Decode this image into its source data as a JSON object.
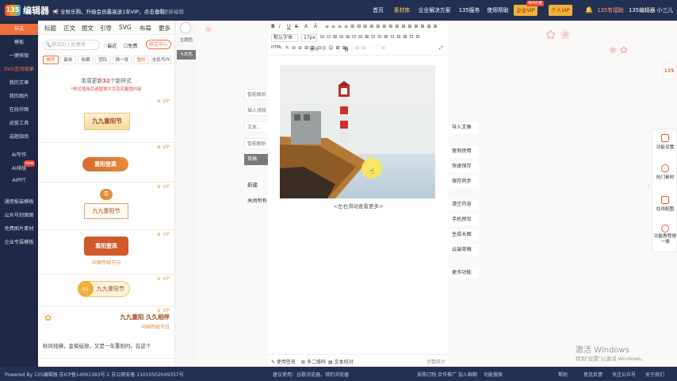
{
  "header": {
    "logo_badge": "135",
    "logo_text": "编辑器",
    "announcement": "全秋乐购，升级会员最高送1年VIP，点击查看",
    "settings": "更新编辑",
    "nav": [
      "首页",
      "素材库",
      "企业解决方案",
      "135服务",
      "使用帮助"
    ],
    "enterprise_vip": "企业VIP",
    "enterprise_badge": "限时优惠",
    "personal_vip": "个人VIP",
    "user_link": "135有福助",
    "user_name": "135编辑器 小三儿"
  },
  "sidebar": {
    "items": [
      "样式",
      "模板",
      "一键排版",
      "SVG互动效果",
      "我的文章",
      "我的图片",
      "在线作图",
      "运营工具",
      "选题指南",
      "AI写作",
      "AI排版",
      "AIPPT",
      "通用报装模板",
      "公众号封面图",
      "免费图片素材",
      "企业专属模板"
    ],
    "new_badge": "new"
  },
  "panel": {
    "tabs": [
      "标题",
      "正文",
      "图文",
      "引导",
      "SVG",
      "布局",
      "更多"
    ],
    "search_placeholder": "样式ID / 关键词",
    "recent": "最近",
    "free": "免费",
    "style_center": "样式中心",
    "subtabs": [
      "推荐",
      "最新",
      "收藏",
      "团队",
      "换一批",
      "重阳",
      "全民写作"
    ],
    "update_notice_prefix": "本周更新",
    "update_count": "32",
    "update_notice_suffix": "个新样式",
    "update_hint": "*样式使用目请替换文字及实量图内容",
    "vip": "VIP",
    "styles": [
      "九九重阳节",
      "重阳登高",
      "壹",
      "九九重阳节",
      "重阳登高",
      "中国传统节日",
      "01",
      "九九重阳节",
      "九九重阳 久久相伴",
      "中国传统节日",
      "秋风轻拂，金菊绽放，又是一年重阳时。在这个",
      "..."
    ]
  },
  "midstrip": {
    "theme": "主题色",
    "wood": "木色"
  },
  "toolbar": {
    "row1": [
      "B",
      "I",
      "U",
      "S",
      "A",
      "Ā",
      "≡",
      "≡",
      "≡",
      "≡",
      "⋮",
      "⊞",
      "⊞",
      "⊞",
      "⊞",
      "⊞",
      "⊞",
      "⊞",
      "⊞",
      "⊞",
      "⊞"
    ],
    "font_family": "默认字体",
    "font_size": "17px",
    "row3_label": "HTML",
    "import": "导入",
    "note": "备"
  },
  "editor": {
    "caption": "<左右滑动查看更多>",
    "left_ghosts": [
      "智能解析",
      "插入排版",
      "文本...",
      "智能解析"
    ],
    "draft": "草稿",
    "new": "新建",
    "close_all": "关闭所有",
    "status": [
      "使用签名",
      "多二维码",
      "文本校对"
    ],
    "word_count": "字数统计"
  },
  "side_actions": [
    "导入文章",
    "复制使用",
    "快速保存",
    "保存同步",
    "清空内容",
    "手机预览",
    "生成长图",
    "云端草稿",
    "更多功能"
  ],
  "right_rail": [
    "功能设置",
    "热门素材",
    "在线配图",
    "功能教程搜一搜"
  ],
  "footer": {
    "left": "Powered By 135编辑器 苏ICP备14061383号-1 苏公网安备 11010502049357号",
    "middle": "建议使用：谷歌浏览器，猎豹浏览器",
    "links": [
      "采购订制",
      "合作推广",
      "加入群聊",
      "功能搜索",
      "帮助",
      "意见反馈",
      "关注公众号",
      "关于我们"
    ]
  },
  "watermark": {
    "title": "激活 Windows",
    "sub": "转到\"设置\"以激活 Windows。"
  },
  "colors": {
    "topbar": "#243052",
    "accent": "#ef6d3a",
    "gold": "#f4b03a"
  }
}
